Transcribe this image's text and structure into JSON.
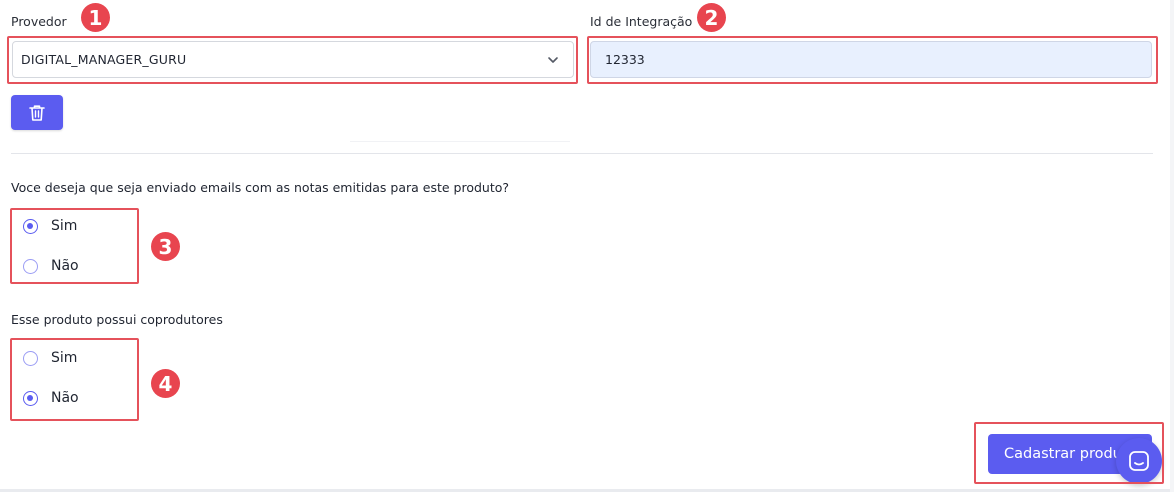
{
  "provider": {
    "label": "Provedor",
    "selected": "DIGITAL_MANAGER_GURU"
  },
  "integration": {
    "label": "Id de Integração",
    "value": "12333"
  },
  "email_question": {
    "text": "Voce deseja que seja enviado emails com as notas emitidas para este produto?",
    "options": [
      "Sim",
      "Não"
    ],
    "selected": "Sim"
  },
  "coproducers_question": {
    "text": "Esse produto possui coprodutores",
    "options": [
      "Sim",
      "Não"
    ],
    "selected": "Não"
  },
  "submit": {
    "label": "Cadastrar produto"
  },
  "annotations": [
    "1",
    "2",
    "3",
    "4"
  ],
  "colors": {
    "accent": "#5b5cf0",
    "highlight": "#e5525b",
    "badge": "#e8454f",
    "input_fill": "#e8f0fe"
  },
  "icons": {
    "delete": "trash-icon",
    "dropdown": "chevron-down-icon",
    "chat": "chat-icon"
  }
}
